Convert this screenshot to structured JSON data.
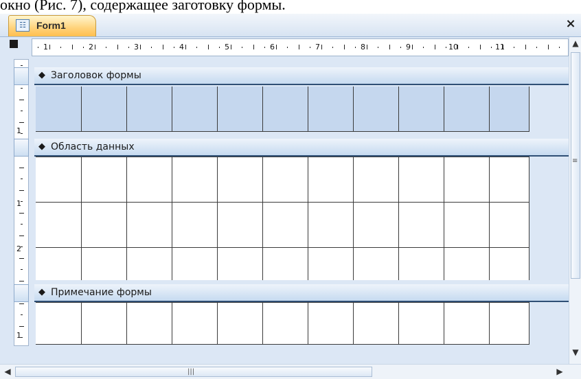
{
  "caption_text": "окно (Рис. 7), содержащее заготовку формы.",
  "window": {
    "tab_title": "Form1",
    "close_glyph": "×",
    "form_icon_glyph": "☷"
  },
  "ruler": {
    "horizontal_numbers": [
      "1",
      "2",
      "3",
      "4",
      "5",
      "6",
      "7",
      "8",
      "9",
      "10",
      "11"
    ],
    "vertical_numbers": [
      "1",
      "1",
      "2",
      "1"
    ]
  },
  "sections": [
    {
      "label": "Заголовок формы",
      "icon": "collapse-arrow-icon"
    },
    {
      "label": "Область данных",
      "icon": "collapse-arrow-icon"
    },
    {
      "label": "Примечание формы",
      "icon": "collapse-arrow-icon"
    }
  ],
  "scrollbars": {
    "up": "▲",
    "down": "▼",
    "left": "◀",
    "right": "▶",
    "grip_v": "≡",
    "grip_h": "|||"
  },
  "colors": {
    "tab_accent": "#ffbf4f",
    "band_fill": "#c6daf0",
    "header_grid_fill": "#c5d7ee",
    "frame_bg": "#dce7f5"
  }
}
